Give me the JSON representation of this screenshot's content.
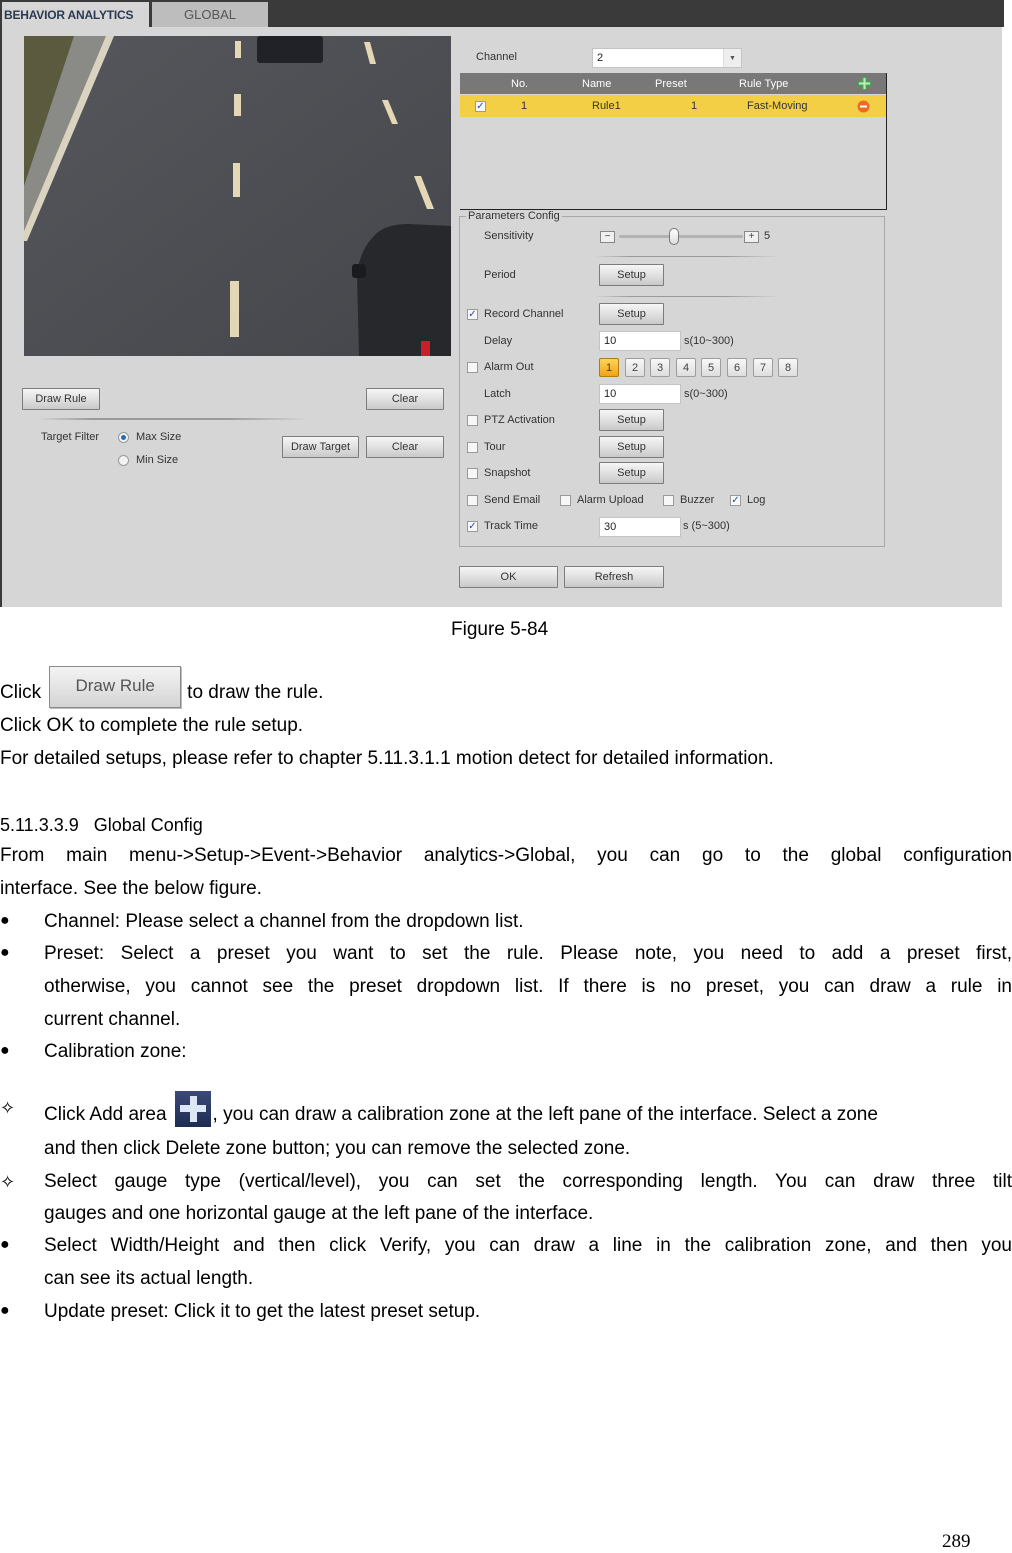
{
  "figure": {
    "tabs": [
      {
        "label": "BEHAVIOR ANALYTICS",
        "active": true
      },
      {
        "label": "GLOBAL",
        "active": false
      }
    ],
    "left_pane": {
      "draw_rule_label": "Draw Rule",
      "clear_label": "Clear",
      "target_filter_label": "Target Filter",
      "target_filter_options": [
        {
          "label": "Max Size",
          "selected": true
        },
        {
          "label": "Min Size",
          "selected": false
        }
      ],
      "draw_target_label": "Draw Target",
      "clear_target_label": "Clear"
    },
    "channel": {
      "label": "Channel",
      "value": "2"
    },
    "rule_table": {
      "columns": [
        "No.",
        "Name",
        "Preset",
        "Rule Type"
      ],
      "rows": [
        {
          "checked": true,
          "no": "1",
          "name": "Rule1",
          "preset": "1",
          "rule_type": "Fast-Moving"
        }
      ],
      "colors": {
        "header": "#787878",
        "selected_row": "#f3cf45",
        "add": "#3bb34a",
        "delete": "#f06a1f"
      }
    },
    "params": {
      "title": "Parameters Config",
      "sensitivity": {
        "label": "Sensitivity",
        "value": "5",
        "level_fraction": 0.44
      },
      "period": {
        "label": "Period",
        "button": "Setup"
      },
      "record_channel": {
        "label": "Record Channel",
        "checked": true,
        "button": "Setup"
      },
      "delay": {
        "label": "Delay",
        "value": "10",
        "range": "s(10~300)"
      },
      "alarm_out": {
        "label": "Alarm Out",
        "checked": false,
        "outputs": [
          "1",
          "2",
          "3",
          "4",
          "5",
          "6",
          "7",
          "8"
        ],
        "selected": "1"
      },
      "latch": {
        "label": "Latch",
        "value": "10",
        "range": "s(0~300)"
      },
      "ptz_activation": {
        "label": "PTZ Activation",
        "checked": false,
        "button": "Setup"
      },
      "tour": {
        "label": "Tour",
        "checked": false,
        "button": "Setup"
      },
      "snapshot": {
        "label": "Snapshot",
        "checked": false,
        "button": "Setup"
      },
      "send_email": {
        "label": "Send Email",
        "checked": false
      },
      "alarm_upload": {
        "label": "Alarm Upload",
        "checked": false
      },
      "buzzer": {
        "label": "Buzzer",
        "checked": false
      },
      "log": {
        "label": "Log",
        "checked": true
      },
      "track_time": {
        "label": "Track Time",
        "checked": true,
        "value": "30",
        "range": "s (5~300)"
      }
    },
    "ok_label": "OK",
    "refresh_label": "Refresh",
    "caption": "Figure 5-84"
  },
  "document": {
    "click_prefix": "Click",
    "inline_button_label": "Draw Rule",
    "click_suffix": "to draw the rule.",
    "line_ok": "Click OK to complete the rule setup.",
    "line_refer": "For detailed setups, please refer to chapter 5.11.3.1.1 motion detect for detailed information.",
    "section_number": "5.11.3.3.9",
    "section_title": "Global Config",
    "intro_line1": "From main menu->Setup->Event->Behavior analytics->Global, you can go to the global configuration",
    "intro_line2": "interface. See the below figure.",
    "bullets": [
      {
        "lines": [
          "Channel: Please select a channel from the dropdown list."
        ]
      },
      {
        "lines": [
          "Preset: Select a preset you want to set the rule. Please note, you need to add a preset first,",
          "otherwise, you cannot see the preset dropdown list. If there is no preset, you can draw a rule in",
          "current channel."
        ]
      },
      {
        "lines": [
          "Calibration zone:"
        ]
      }
    ],
    "sub_bullets": [
      {
        "prefix": "Click Add area",
        "suffix": ", you can draw a calibration zone at the left pane of the interface. Select a zone",
        "line2": "and then click Delete zone button; you can remove the selected zone."
      },
      {
        "line1": "Select gauge type (vertical/level), you can set the corresponding length. You can draw three tilt",
        "line2": "gauges and one horizontal gauge at the left pane of the interface."
      }
    ],
    "bullets2": [
      {
        "lines": [
          "Select Width/Height and then click Verify, you can draw a line in the calibration zone, and then you",
          "can see its actual length."
        ]
      },
      {
        "lines": [
          "Update preset: Click it to get the latest preset setup."
        ]
      }
    ],
    "bullet_glyph": "●",
    "sub_bullet_glyph": "✧",
    "page_number": "289"
  }
}
